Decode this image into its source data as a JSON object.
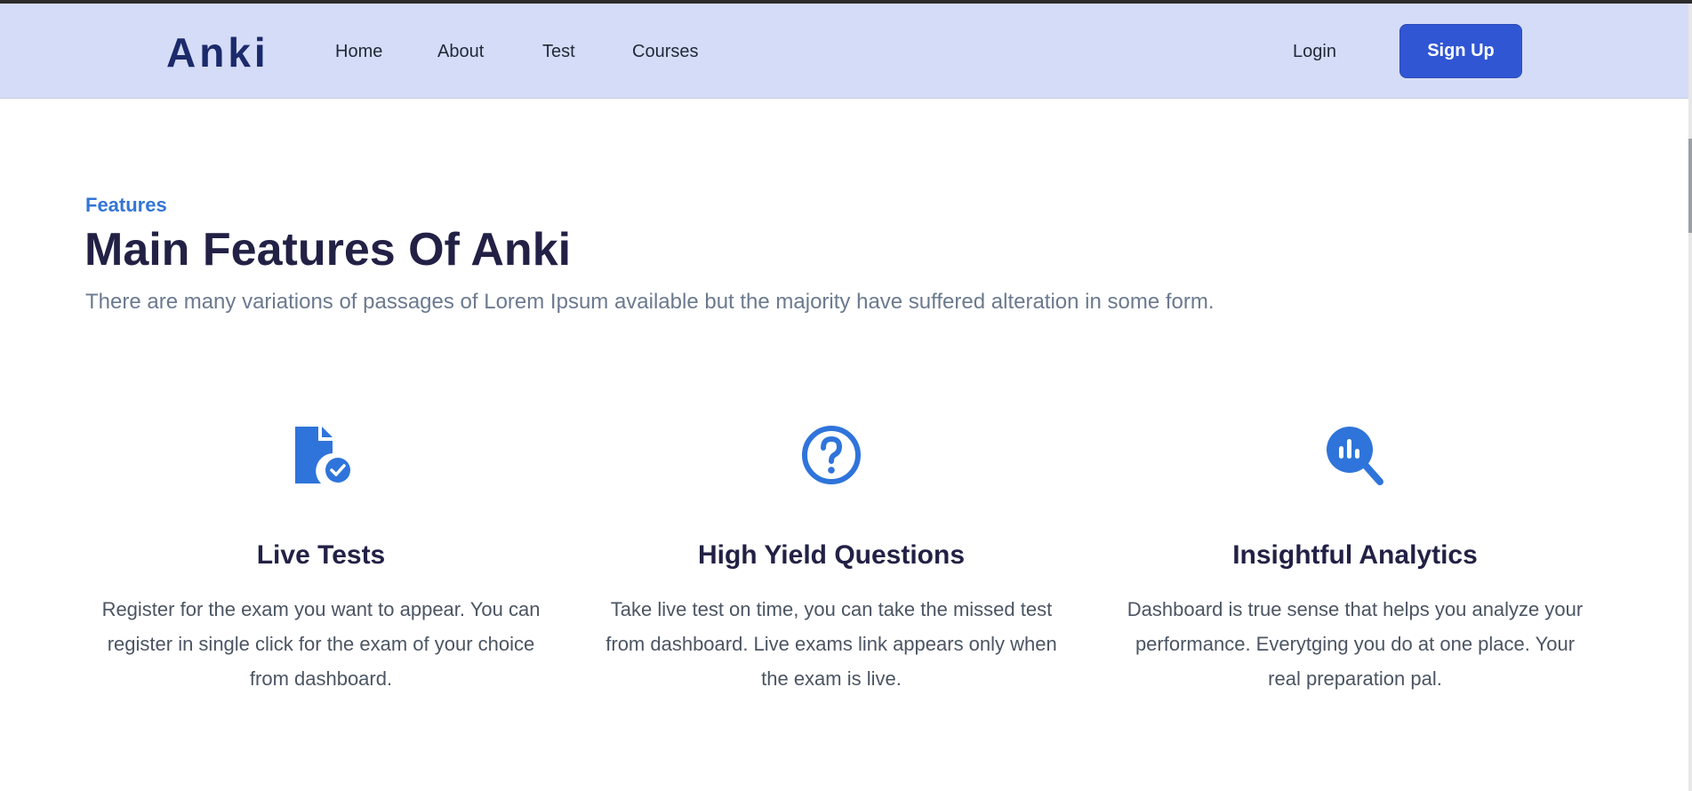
{
  "brand": {
    "logo": "Anki"
  },
  "nav": {
    "links": [
      "Home",
      "About",
      "Test",
      "Courses"
    ],
    "login_label": "Login",
    "signup_label": "Sign Up"
  },
  "section": {
    "eyebrow": "Features",
    "title": "Main Features Of Anki",
    "subtitle": "There are many variations of passages of Lorem Ipsum available but the majority have suffered alteration in some form."
  },
  "features": [
    {
      "icon": "document-check-icon",
      "title": "Live Tests",
      "description": "Register for the exam you want to appear. You can register in single click for the exam of your choice from dashboard."
    },
    {
      "icon": "question-circle-icon",
      "title": "High Yield Questions",
      "description": "Take live test on time, you can take the missed test from dashboard. Live exams link appears only when the exam is live."
    },
    {
      "icon": "analytics-search-icon",
      "title": "Insightful Analytics",
      "description": "Dashboard is true sense that helps you analyze your performance. Everytging you do at one place. Your real preparation pal."
    }
  ],
  "colors": {
    "navbar_bg": "#d5dcf7",
    "brand_dark": "#1b2a6b",
    "accent_blue": "#3056d3",
    "icon_blue": "#2f74db",
    "heading": "#222145"
  }
}
